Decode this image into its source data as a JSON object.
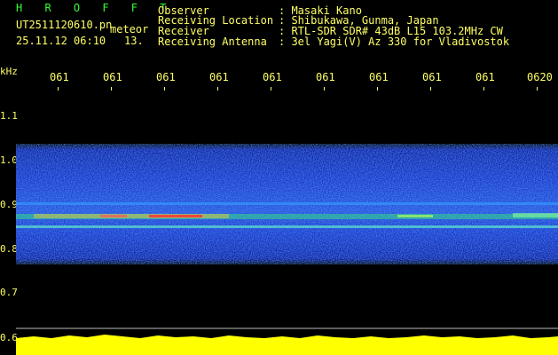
{
  "header": {
    "station_code": "H R O F F T",
    "file_name": "UT2511120610.pn",
    "file_suffix": "meteor",
    "timestamp": "25.11.12 06:10",
    "count": "13.",
    "info": [
      {
        "label": "Observer",
        "value": ": Masaki Kano"
      },
      {
        "label": "Receiving Location",
        "value": ": Shibukawa, Gunma, Japan"
      },
      {
        "label": "Receiver",
        "value": ": RTL-SDR SDR# 43dB L15 103.2MHz CW"
      },
      {
        "label": "Receiving Antenna",
        "value": ": 3el Yagi(V) Az 330 for Vladivostok"
      }
    ]
  },
  "axis": {
    "unit": "kHz",
    "y_labels": [
      "1.1",
      "1.0",
      "0.9",
      "0.8",
      "0.7",
      "0.6"
    ],
    "x_labels": [
      "061",
      "061",
      "061",
      "061",
      "061",
      "061",
      "061",
      "061",
      "061",
      "0620"
    ]
  },
  "colors": {
    "background": "#000000",
    "label": "#ffff66",
    "station": "#33ff33",
    "noise_floor": "#ffff00"
  }
}
